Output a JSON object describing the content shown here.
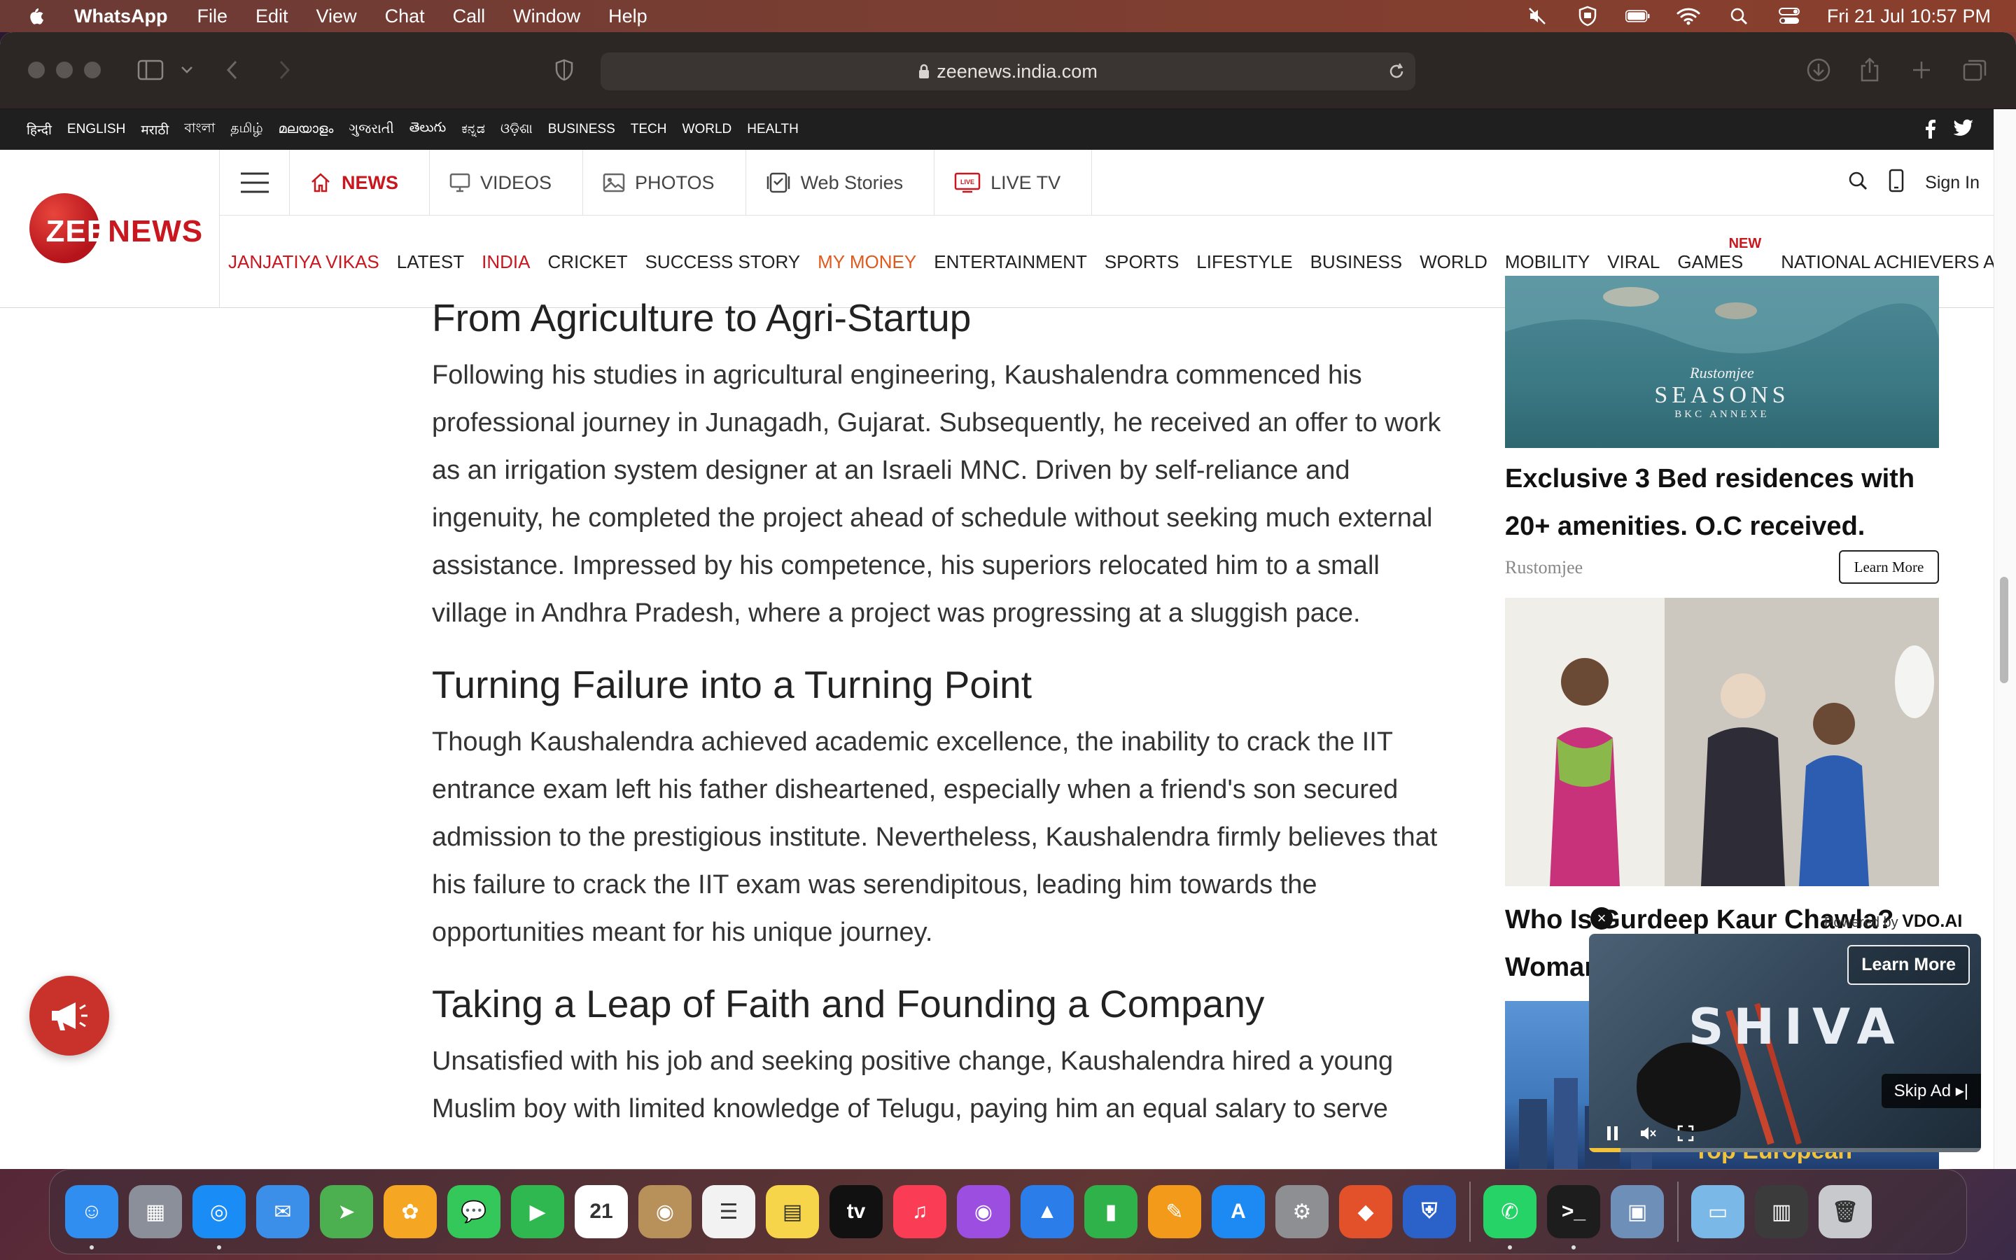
{
  "menubar": {
    "app_name": "WhatsApp",
    "menus": [
      "File",
      "Edit",
      "View",
      "Chat",
      "Call",
      "Window",
      "Help"
    ],
    "clock": "Fri 21 Jul  10:57 PM"
  },
  "browser": {
    "url": "zeenews.india.com"
  },
  "langbar": {
    "items": [
      "हिन्दी",
      "ENGLISH",
      "मराठी",
      "বাংলা",
      "தமிழ்",
      "മലയാളം",
      "ગુજરાતી",
      "తెలుగు",
      "ಕನ್ನಡ",
      "ଓଡ଼ିଶା",
      "BUSINESS",
      "TECH",
      "WORLD",
      "HEALTH"
    ]
  },
  "logo": {
    "zee": "ZEE",
    "news": "NEWS"
  },
  "navtop": {
    "tabs": [
      {
        "label": "NEWS",
        "icon": "home-icon"
      },
      {
        "label": "VIDEOS",
        "icon": "monitor-icon"
      },
      {
        "label": "PHOTOS",
        "icon": "photo-icon"
      },
      {
        "label": "Web Stories",
        "icon": "web-stories-icon"
      },
      {
        "label": "LIVE TV",
        "icon": "live-tv-icon"
      }
    ],
    "sign_in": "Sign In"
  },
  "navbottom": {
    "items": [
      {
        "label": "JANJATIYA VIKAS",
        "color": "#c8171e"
      },
      {
        "label": "LATEST"
      },
      {
        "label": "INDIA",
        "color": "#c8171e"
      },
      {
        "label": "CRICKET"
      },
      {
        "label": "SUCCESS STORY"
      },
      {
        "label": "MY MONEY",
        "color": "#e05a1c"
      },
      {
        "label": "ENTERTAINMENT"
      },
      {
        "label": "SPORTS"
      },
      {
        "label": "LIFESTYLE"
      },
      {
        "label": "BUSINESS"
      },
      {
        "label": "WORLD"
      },
      {
        "label": "MOBILITY"
      },
      {
        "label": "VIRAL"
      },
      {
        "label": "GAMES",
        "badge": "NEW"
      },
      {
        "label": "NATIONAL ACHIEVERS AWARD"
      }
    ]
  },
  "article": {
    "sections": [
      {
        "heading": "From Agriculture to Agri-Startup",
        "body": "Following his studies in agricultural engineering, Kaushalendra commenced his professional journey in Junagadh, Gujarat. Subsequently, he received an offer to work as an irrigation system designer at an Israeli MNC. Driven by self-reliance and ingenuity, he completed the project ahead of schedule without seeking much external assistance. Impressed by his competence, his superiors relocated him to a small village in Andhra Pradesh, where a project was progressing at a sluggish pace."
      },
      {
        "heading": "Turning Failure into a Turning Point",
        "body": "Though Kaushalendra achieved academic excellence, the inability to crack the IIT entrance exam left his father disheartened, especially when a friend's son secured admission to the prestigious institute. Nevertheless, Kaushalendra firmly believes that his failure to crack the IIT exam was serendipitous, leading him towards the opportunities meant for his unique journey."
      },
      {
        "heading": "Taking a Leap of Faith and Founding a Company",
        "body": "Unsatisfied with his job and seeking positive change, Kaushalendra hired a young Muslim boy with limited knowledge of Telugu, paying him an equal salary to serve"
      }
    ]
  },
  "sidebar": {
    "ad1": {
      "brand": "Rustomjee",
      "brand_line": "SEASONS",
      "brand_sub": "BKC ANNEXE",
      "title": "Exclusive 3 Bed residences with 20+ amenities. O.C received.",
      "source": "Rustomjee",
      "cta": "Learn More"
    },
    "ad2": {
      "title": "Who Is Gurdeep Kaur Chawla? Woman"
    },
    "ad3": {
      "caption": "Top European"
    },
    "video": {
      "powered_by": "Powered by",
      "provider": "VDO.AI",
      "learn_more": "Learn More",
      "title": "SHIVA",
      "skip": "Skip Ad ▸|"
    }
  },
  "dock": {
    "apps": [
      {
        "name": "Finder",
        "color": "#2f8ef0",
        "glyph": "☺",
        "running": true
      },
      {
        "name": "Launchpad",
        "color": "#8a8f99",
        "glyph": "▦"
      },
      {
        "name": "Safari",
        "color": "#1a8cf5",
        "glyph": "◎",
        "running": true
      },
      {
        "name": "Mail",
        "color": "#3c8fe8",
        "glyph": "✉"
      },
      {
        "name": "Maps",
        "color": "#4caf50",
        "glyph": "➤"
      },
      {
        "name": "Photos",
        "color": "#f5a623",
        "glyph": "✿"
      },
      {
        "name": "Messages",
        "color": "#34c759",
        "glyph": "💬"
      },
      {
        "name": "FaceTime",
        "color": "#2eb84f",
        "glyph": "▶"
      },
      {
        "name": "Calendar",
        "color": "#ffffff",
        "glyph": "21"
      },
      {
        "name": "Contacts",
        "color": "#b8905a",
        "glyph": "◉"
      },
      {
        "name": "Reminders",
        "color": "#f2f2f2",
        "glyph": "☰"
      },
      {
        "name": "Notes",
        "color": "#f7d54a",
        "glyph": "▤"
      },
      {
        "name": "TV",
        "color": "#111111",
        "glyph": "tv"
      },
      {
        "name": "Music",
        "color": "#fa3c54",
        "glyph": "♫"
      },
      {
        "name": "Podcasts",
        "color": "#9b4ee0",
        "glyph": "◉"
      },
      {
        "name": "Keynote",
        "color": "#2b7de9",
        "glyph": "▲"
      },
      {
        "name": "Numbers",
        "color": "#2fb24a",
        "glyph": "▮"
      },
      {
        "name": "Pages",
        "color": "#f49a1a",
        "glyph": "✎"
      },
      {
        "name": "App Store",
        "color": "#1c8af2",
        "glyph": "A"
      },
      {
        "name": "System Preferences",
        "color": "#8d8f93",
        "glyph": "⚙"
      },
      {
        "name": "AnyDesk",
        "color": "#e2512a",
        "glyph": "◆"
      },
      {
        "name": "VPN",
        "color": "#2a62c9",
        "glyph": "⛨"
      },
      {
        "name": "WhatsApp",
        "color": "#25d366",
        "glyph": "✆",
        "running": true
      },
      {
        "name": "Terminal",
        "color": "#1d1d1d",
        "glyph": ">_",
        "running": true
      },
      {
        "name": "Preview",
        "color": "#6d8fb8",
        "glyph": "▣"
      },
      {
        "name": "Downloads",
        "color": "#7ab8e8",
        "glyph": "▭"
      },
      {
        "name": "Screens",
        "color": "#3b3b3b",
        "glyph": "▥"
      },
      {
        "name": "Trash",
        "color": "#c7c9cc",
        "glyph": "🗑"
      }
    ]
  }
}
